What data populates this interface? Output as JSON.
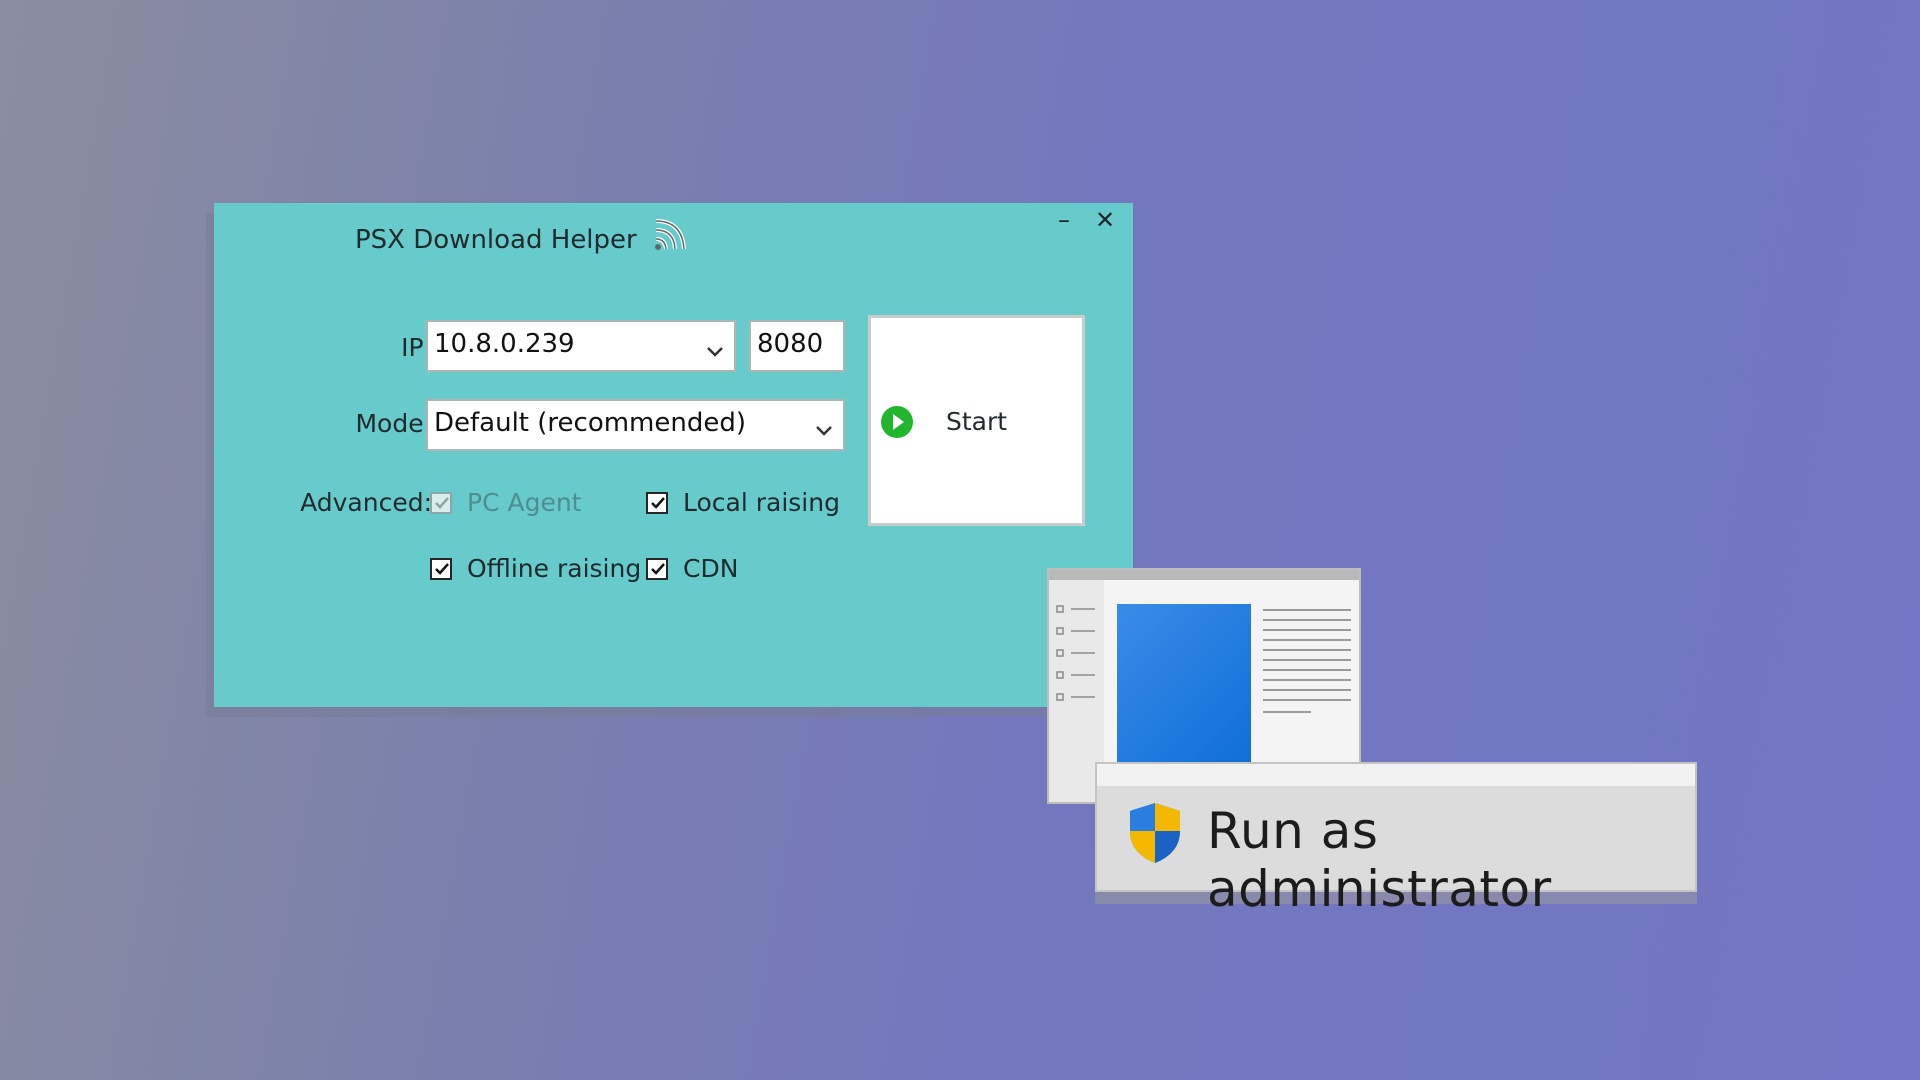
{
  "window": {
    "title": "PSX Download Helper",
    "minimize_symbol": "–",
    "close_symbol": "✕",
    "background_color": "#67cbcc"
  },
  "form": {
    "ip_label": "IP:",
    "ip_value": "10.8.0.239",
    "port_value": "8080",
    "mode_label": "Mode:",
    "mode_value": "Default (recommended)",
    "advanced_label": "Advanced:",
    "options": [
      {
        "label": "PC Agent",
        "checked": true,
        "disabled": true
      },
      {
        "label": "Local raising",
        "checked": true,
        "disabled": false
      },
      {
        "label": "Offline raising",
        "checked": true,
        "disabled": false
      },
      {
        "label": "CDN",
        "checked": true,
        "disabled": false
      }
    ]
  },
  "start_button": {
    "label": "Start",
    "icon": "play-icon",
    "icon_color": "#22b52e"
  },
  "admin_prompt": {
    "label": "Run as administrator",
    "icon": "uac-shield-icon"
  },
  "icons": {
    "title_icon": "rss-icon",
    "dropdown": "chevron-down-icon",
    "checkbox": "check-icon"
  }
}
